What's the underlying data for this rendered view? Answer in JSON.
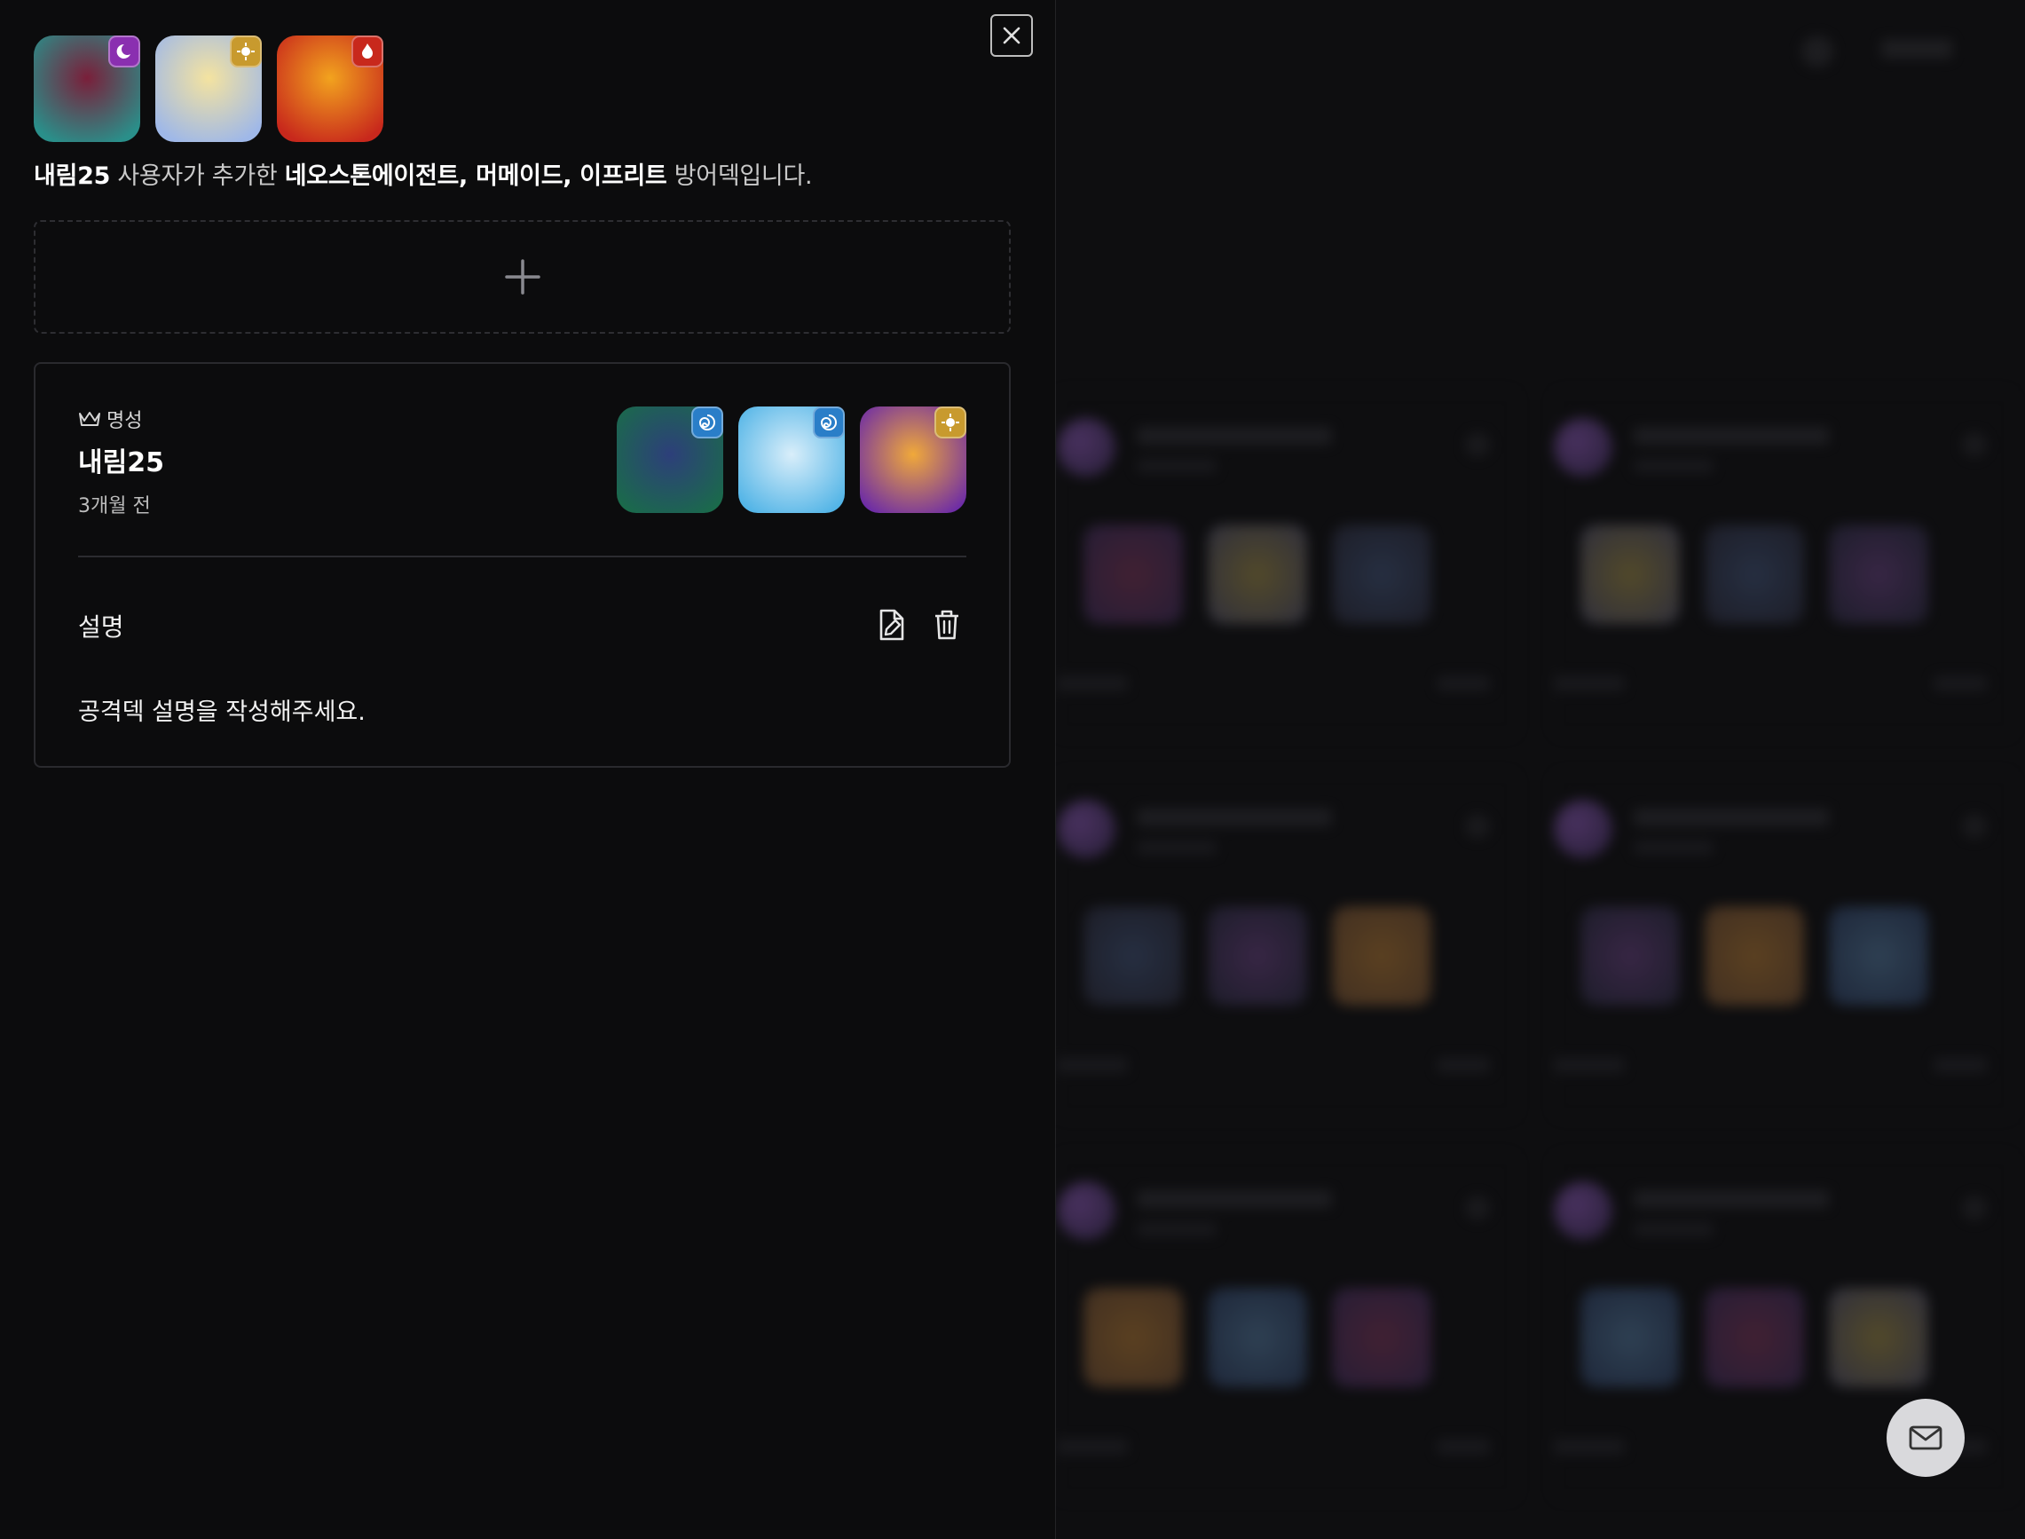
{
  "modal": {
    "summary": {
      "author": "내림25",
      "middle": " 사용자가 추가한 ",
      "units_text": "네오스톤에이전트, 머메이드, 이프리트",
      "suffix": " 방어덱입니다."
    },
    "defense_units": [
      {
        "name": "네오스톤에이전트",
        "element": "dark",
        "colors": [
          "#7a1f3a",
          "#2a8f8a"
        ]
      },
      {
        "name": "머메이드",
        "element": "light",
        "colors": [
          "#f4e3a0",
          "#9fb8e8"
        ]
      },
      {
        "name": "이프리트",
        "element": "fire",
        "colors": [
          "#f2a31e",
          "#c8281c"
        ]
      }
    ],
    "card": {
      "rank_label": "명성",
      "author_name": "내림25",
      "time_ago": "3개월 전",
      "attack_units": [
        {
          "element": "water",
          "colors": [
            "#2d3f7a",
            "#1a6b4a"
          ]
        },
        {
          "element": "water",
          "colors": [
            "#d9eefa",
            "#4fb3e6"
          ]
        },
        {
          "element": "light",
          "colors": [
            "#f0a93a",
            "#6b2aa8"
          ]
        }
      ],
      "description_label": "설명",
      "description_text": "공격덱 설명을 작성해주세요."
    }
  },
  "icons": {
    "close": "close-icon",
    "add": "plus-icon",
    "crown": "crown-icon",
    "edit": "edit-document-icon",
    "delete": "trash-icon",
    "mail": "mail-icon"
  },
  "colors": {
    "background": "#0c0c0d",
    "border": "#2a2a2e",
    "dark_badge": "#8a2fb0",
    "light_badge": "#c89a2e",
    "fire_badge": "#c8281c",
    "water_badge": "#2a7ec8"
  }
}
